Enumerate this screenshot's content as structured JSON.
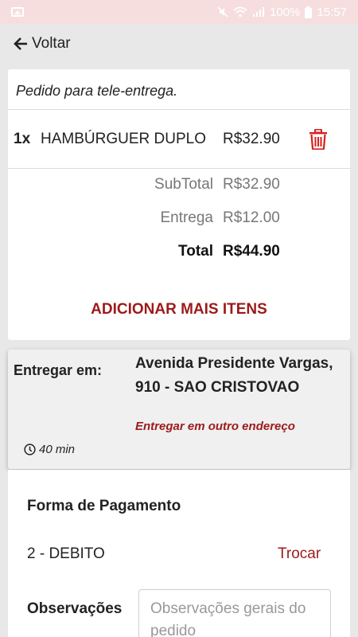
{
  "status_bar": {
    "battery": "100%",
    "time": "15:57"
  },
  "nav": {
    "back_label": "Voltar"
  },
  "order": {
    "type_label": "Pedido para tele-entrega.",
    "items": [
      {
        "qty": "1x",
        "name": "HAMBÚRGUER DUPLO",
        "price": "R$32.90"
      }
    ],
    "subtotal_label": "SubTotal",
    "subtotal_value": "R$32.90",
    "delivery_label": "Entrega",
    "delivery_value": "R$12.00",
    "total_label": "Total",
    "total_value": "R$44.90",
    "add_more_label": "ADICIONAR MAIS ITENS"
  },
  "delivery": {
    "label": "Entregar em:",
    "address_line1": "Avenida Presidente Vargas,",
    "address_line2": "910 - SAO CRISTOVAO",
    "other_address_label": "Entregar em outro endereço",
    "eta": "40 min"
  },
  "payment": {
    "title": "Forma de Pagamento",
    "method": "2 - DEBITO",
    "change_label": "Trocar",
    "observations_label": "Observações",
    "observations_placeholder": "Observações gerais do pedido"
  },
  "colors": {
    "accent": "#9c1a1a",
    "trash": "#d81f1f",
    "background": "#e8e8e8"
  }
}
